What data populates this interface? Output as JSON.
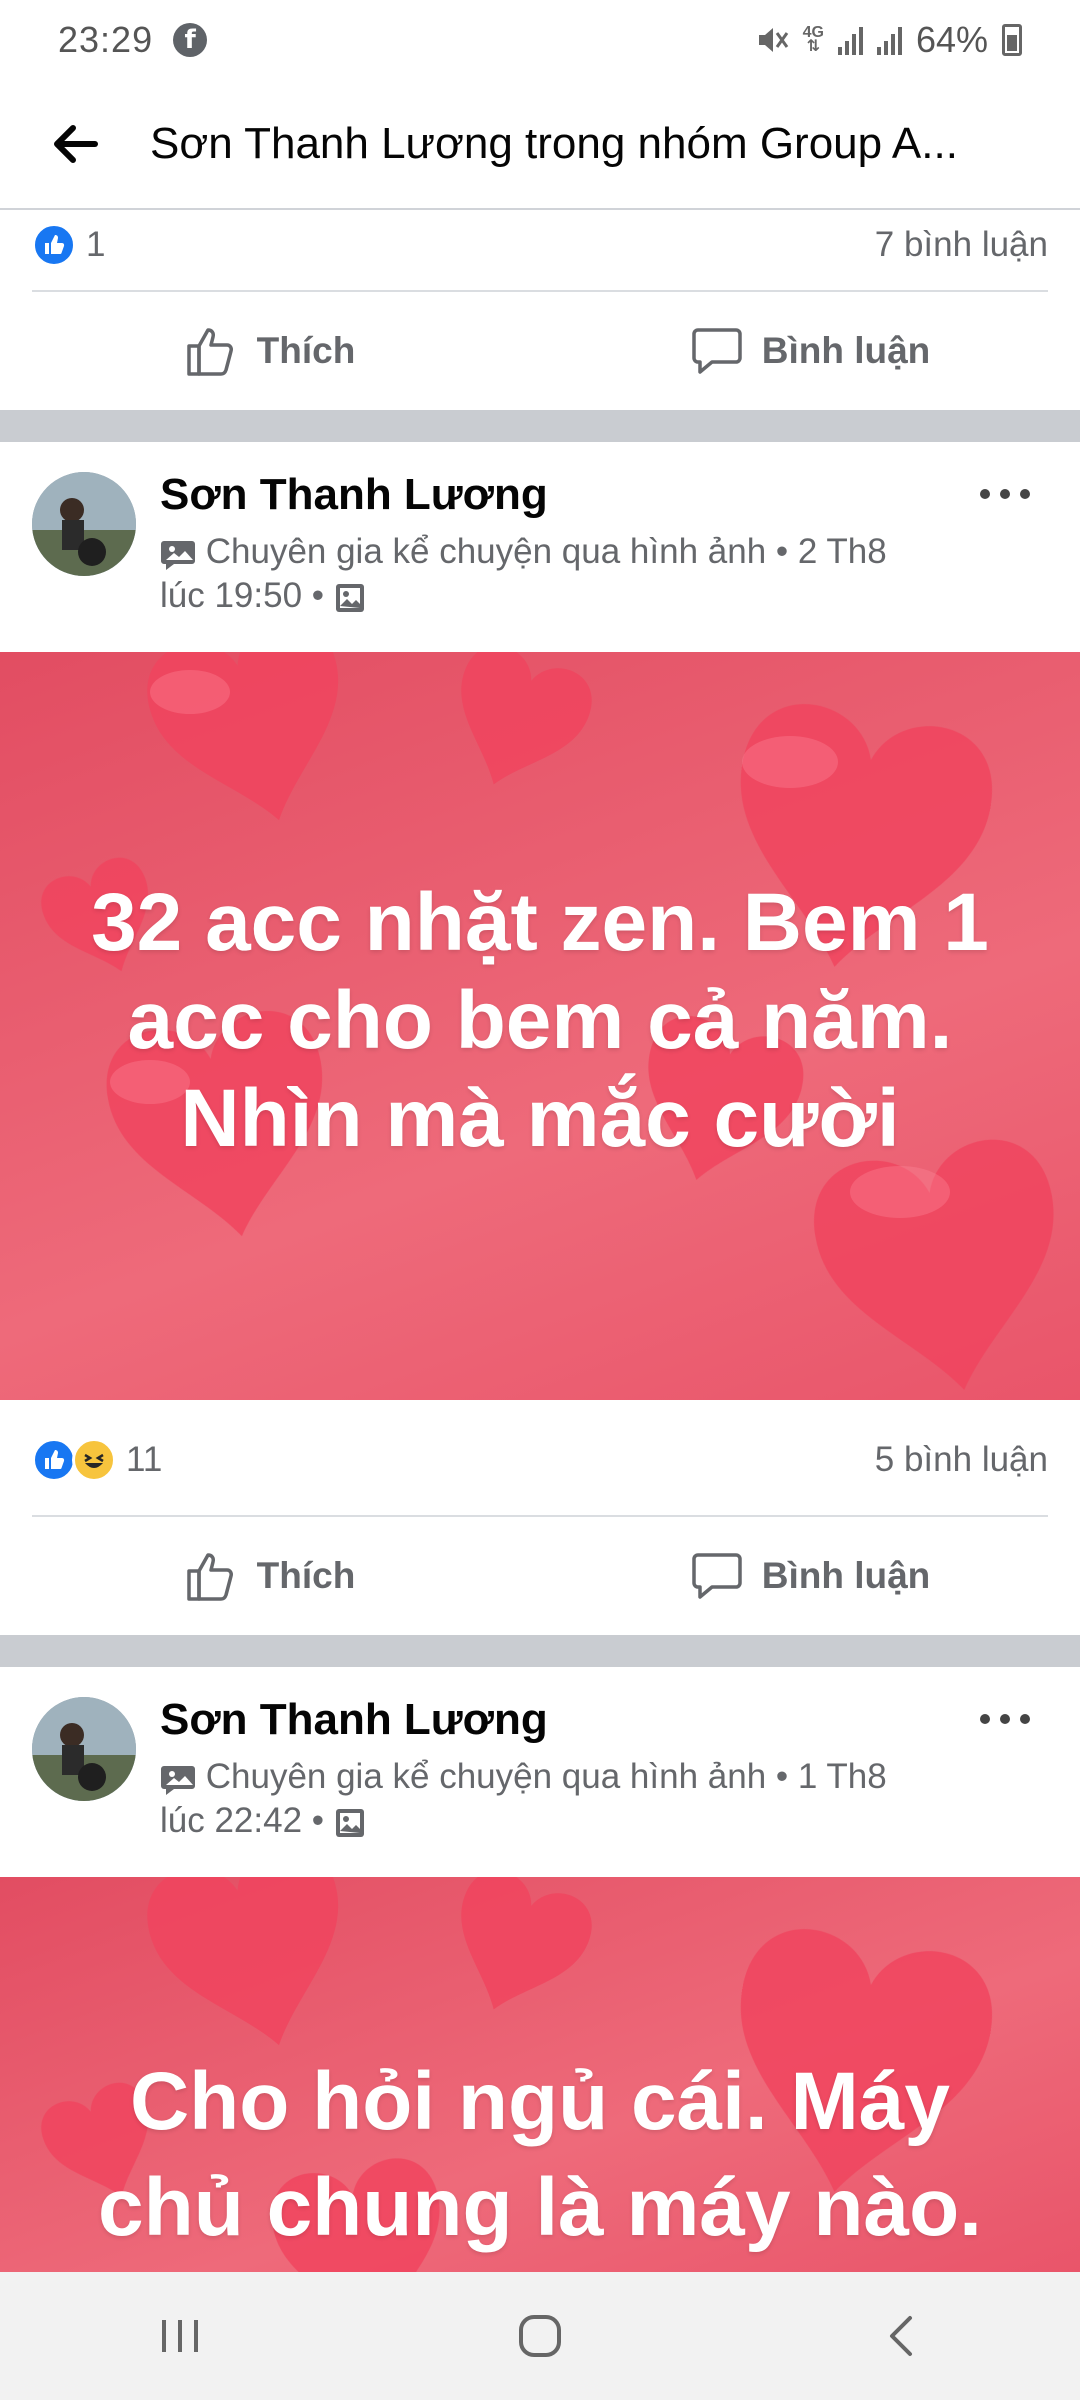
{
  "status_bar": {
    "time": "23:29",
    "app_icon": "facebook-icon",
    "lte_label_top": "4G",
    "battery": "64%"
  },
  "header": {
    "title": "Sơn Thanh Lương trong nhóm Group A...",
    "back_icon": "arrow-left-icon"
  },
  "previous_post_footer": {
    "reaction_count": "1",
    "comment_count": "7 bình luận",
    "like_label": "Thích",
    "comment_label": "Bình luận"
  },
  "posts": [
    {
      "author": "Sơn Thanh Lương",
      "badge": "Chuyên gia kể chuyện qua hình ảnh",
      "date": "2 Th8",
      "time": "lúc 19:50",
      "text_lines": [
        "32 acc nhặt zen. Bem 1",
        "acc cho bem cả năm.",
        "Nhìn mà mắc cười"
      ],
      "reaction_count": "11",
      "comment_count": "5 bình luận",
      "like_label": "Thích",
      "comment_label": "Bình luận"
    },
    {
      "author": "Sơn Thanh Lương",
      "badge": "Chuyên gia kể chuyện qua hình ảnh",
      "date": "1 Th8",
      "time": "lúc 22:42",
      "text_lines": [
        "Cho hỏi ngủ cái. Máy",
        "chủ chung là máy nào."
      ]
    }
  ],
  "colors": {
    "accent": "#1877f2",
    "post_bg": "#e95668",
    "separator": "#c9ccd1",
    "muted_text": "#65676b"
  }
}
